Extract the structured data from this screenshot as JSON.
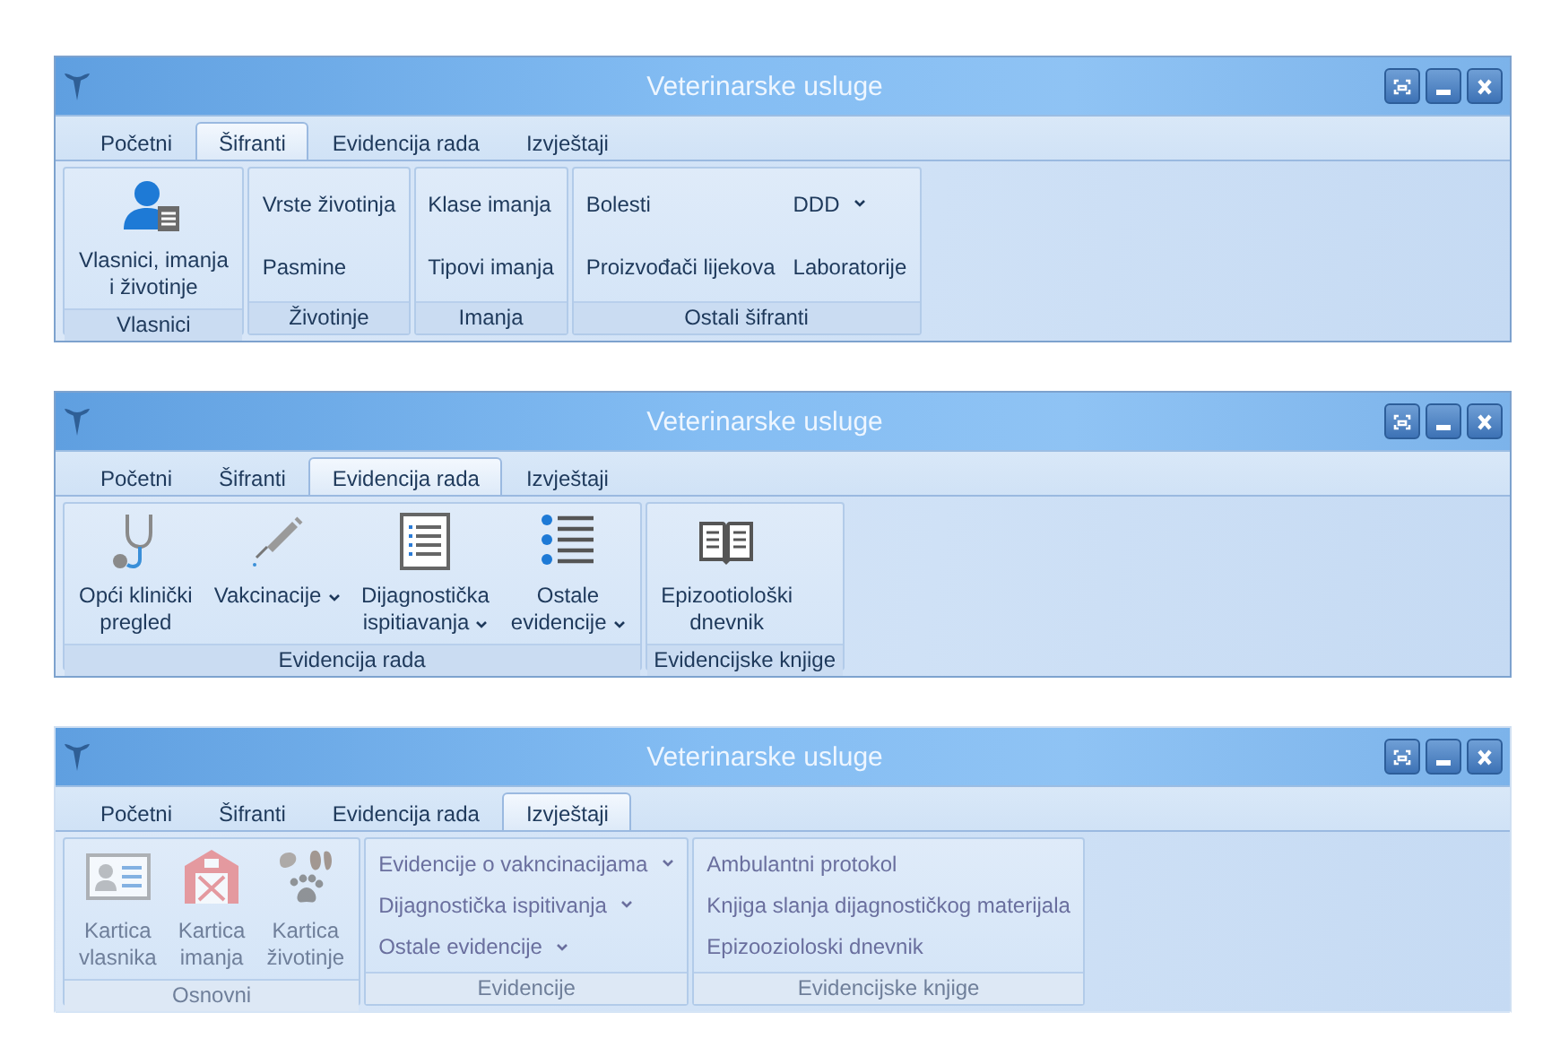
{
  "windows": [
    {
      "title": "Veterinarske usluge",
      "faded": false,
      "tabs": [
        {
          "label": "Početni",
          "selected": false
        },
        {
          "label": "Šifranti",
          "selected": true
        },
        {
          "label": "Evidencija rada",
          "selected": false
        },
        {
          "label": "Izvještaji",
          "selected": false
        }
      ],
      "groups": [
        {
          "label": "Vlasnici",
          "columns": [
            {
              "items": [
                {
                  "kind": "large",
                  "label": "Vlasnici, imanja\ni životinje",
                  "dropdown": false
                }
              ]
            }
          ]
        },
        {
          "label": "Životinje",
          "columns": [
            {
              "items": [
                {
                  "kind": "small",
                  "label": "Vrste životinja",
                  "dropdown": false
                },
                {
                  "kind": "small",
                  "label": "Pasmine",
                  "dropdown": false
                }
              ]
            }
          ]
        },
        {
          "label": "Imanja",
          "columns": [
            {
              "items": [
                {
                  "kind": "small",
                  "label": "Klase imanja",
                  "dropdown": false
                },
                {
                  "kind": "small",
                  "label": "Tipovi imanja",
                  "dropdown": false
                }
              ]
            }
          ]
        },
        {
          "label": "Ostali šifranti",
          "columns": [
            {
              "items": [
                {
                  "kind": "small",
                  "label": "Bolesti",
                  "dropdown": false
                },
                {
                  "kind": "small",
                  "label": "Proizvođači lijekova",
                  "dropdown": false
                }
              ]
            },
            {
              "items": [
                {
                  "kind": "small",
                  "label": "DDD",
                  "dropdown": true
                },
                {
                  "kind": "small",
                  "label": "Laboratorije",
                  "dropdown": false
                }
              ]
            }
          ]
        }
      ]
    },
    {
      "title": "Veterinarske usluge",
      "faded": false,
      "tabs": [
        {
          "label": "Početni",
          "selected": false
        },
        {
          "label": "Šifranti",
          "selected": false
        },
        {
          "label": "Evidencija rada",
          "selected": true
        },
        {
          "label": "Izvještaji",
          "selected": false
        }
      ],
      "groups": [
        {
          "label": "Evidencija rada",
          "columns": [
            {
              "items": [
                {
                  "kind": "large",
                  "label": "Opći klinički\npregled",
                  "dropdown": false
                }
              ]
            },
            {
              "items": [
                {
                  "kind": "large",
                  "label": "Vakcinacije",
                  "dropdown": true
                }
              ]
            },
            {
              "items": [
                {
                  "kind": "large",
                  "label": "Dijagnostička\nispitiavanja",
                  "dropdown": true
                }
              ]
            },
            {
              "items": [
                {
                  "kind": "large",
                  "label": "Ostale\nevidencije",
                  "dropdown": true
                }
              ]
            }
          ]
        },
        {
          "label": "Evidencijske knjige",
          "columns": [
            {
              "items": [
                {
                  "kind": "large",
                  "label": "Epizootiološki\ndnevnik",
                  "dropdown": false
                }
              ]
            }
          ]
        }
      ]
    },
    {
      "title": "Veterinarske usluge",
      "faded": true,
      "tabs": [
        {
          "label": "Početni",
          "selected": false
        },
        {
          "label": "Šifranti",
          "selected": false
        },
        {
          "label": "Evidencija rada",
          "selected": false
        },
        {
          "label": "Izvještaji",
          "selected": true
        }
      ],
      "groups": [
        {
          "label": "Osnovni",
          "columns": [
            {
              "items": [
                {
                  "kind": "large",
                  "label": "Kartica\nvlasnika",
                  "dropdown": false
                }
              ]
            },
            {
              "items": [
                {
                  "kind": "large",
                  "label": "Kartica\nimanja",
                  "dropdown": false
                }
              ]
            },
            {
              "items": [
                {
                  "kind": "large",
                  "label": "Kartica\nživotinje",
                  "dropdown": false
                }
              ]
            }
          ]
        },
        {
          "label": "Evidencije",
          "columns": [
            {
              "items": [
                {
                  "kind": "small",
                  "label": "Evidencije o vakncinacijama",
                  "dropdown": true
                },
                {
                  "kind": "small",
                  "label": "Dijagnostička ispitivanja",
                  "dropdown": true
                },
                {
                  "kind": "small",
                  "label": "Ostale evidencije",
                  "dropdown": true
                }
              ]
            }
          ]
        },
        {
          "label": "Evidencijske knjige",
          "columns": [
            {
              "items": [
                {
                  "kind": "small",
                  "label": "Ambulantni protokol",
                  "dropdown": false
                },
                {
                  "kind": "small",
                  "label": "Knjiga slanja dijagnostičkog materijala",
                  "dropdown": false
                },
                {
                  "kind": "small",
                  "label": "Epizoozioloski dnevnik",
                  "dropdown": false
                }
              ]
            }
          ]
        }
      ]
    }
  ]
}
